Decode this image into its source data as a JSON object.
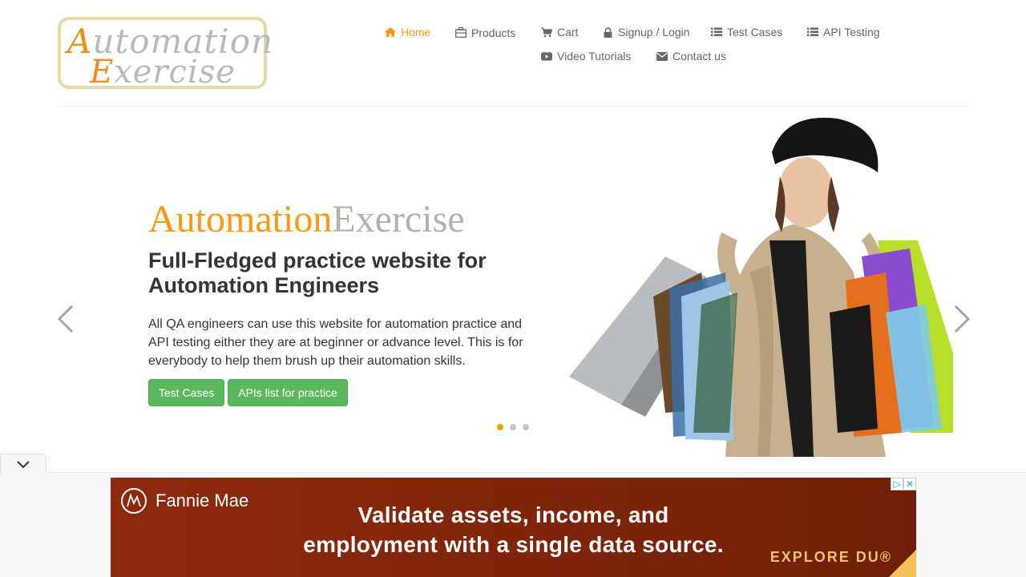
{
  "logo": {
    "line1_a": "A",
    "line1_b": "utomation",
    "line2_a": "E",
    "line2_b": "xercise"
  },
  "nav": [
    {
      "label": "Home",
      "icon": "home-icon"
    },
    {
      "label": "Products",
      "icon": "briefcase-icon"
    },
    {
      "label": "Cart",
      "icon": "cart-icon"
    },
    {
      "label": "Signup / Login",
      "icon": "lock-icon"
    },
    {
      "label": "Test Cases",
      "icon": "list-icon"
    },
    {
      "label": "API Testing",
      "icon": "list-icon"
    },
    {
      "label": "Video Tutorials",
      "icon": "youtube-play-icon"
    },
    {
      "label": "Contact us",
      "icon": "envelope-icon"
    }
  ],
  "slider": {
    "brand_a": "Automation",
    "brand_b": "Exercise",
    "headline": "Full-Fledged practice website for Automation Engineers",
    "description": "All QA engineers can use this website for automation practice and API testing either they are at beginner or advance level. This is for everybody to help them brush up their automation skills.",
    "buttons": [
      "Test Cases",
      "APIs list for practice"
    ],
    "slide_count": 3,
    "active_slide": 1
  },
  "ad": {
    "brand": "Fannie Mae",
    "headline_1": "Validate assets, income, and",
    "headline_2": "employment with a single data source.",
    "cta": "EXPLORE DU®"
  },
  "colors": {
    "accent": "#fe980f",
    "button": "#5cb85c",
    "ad_bg": "#7d240a"
  }
}
